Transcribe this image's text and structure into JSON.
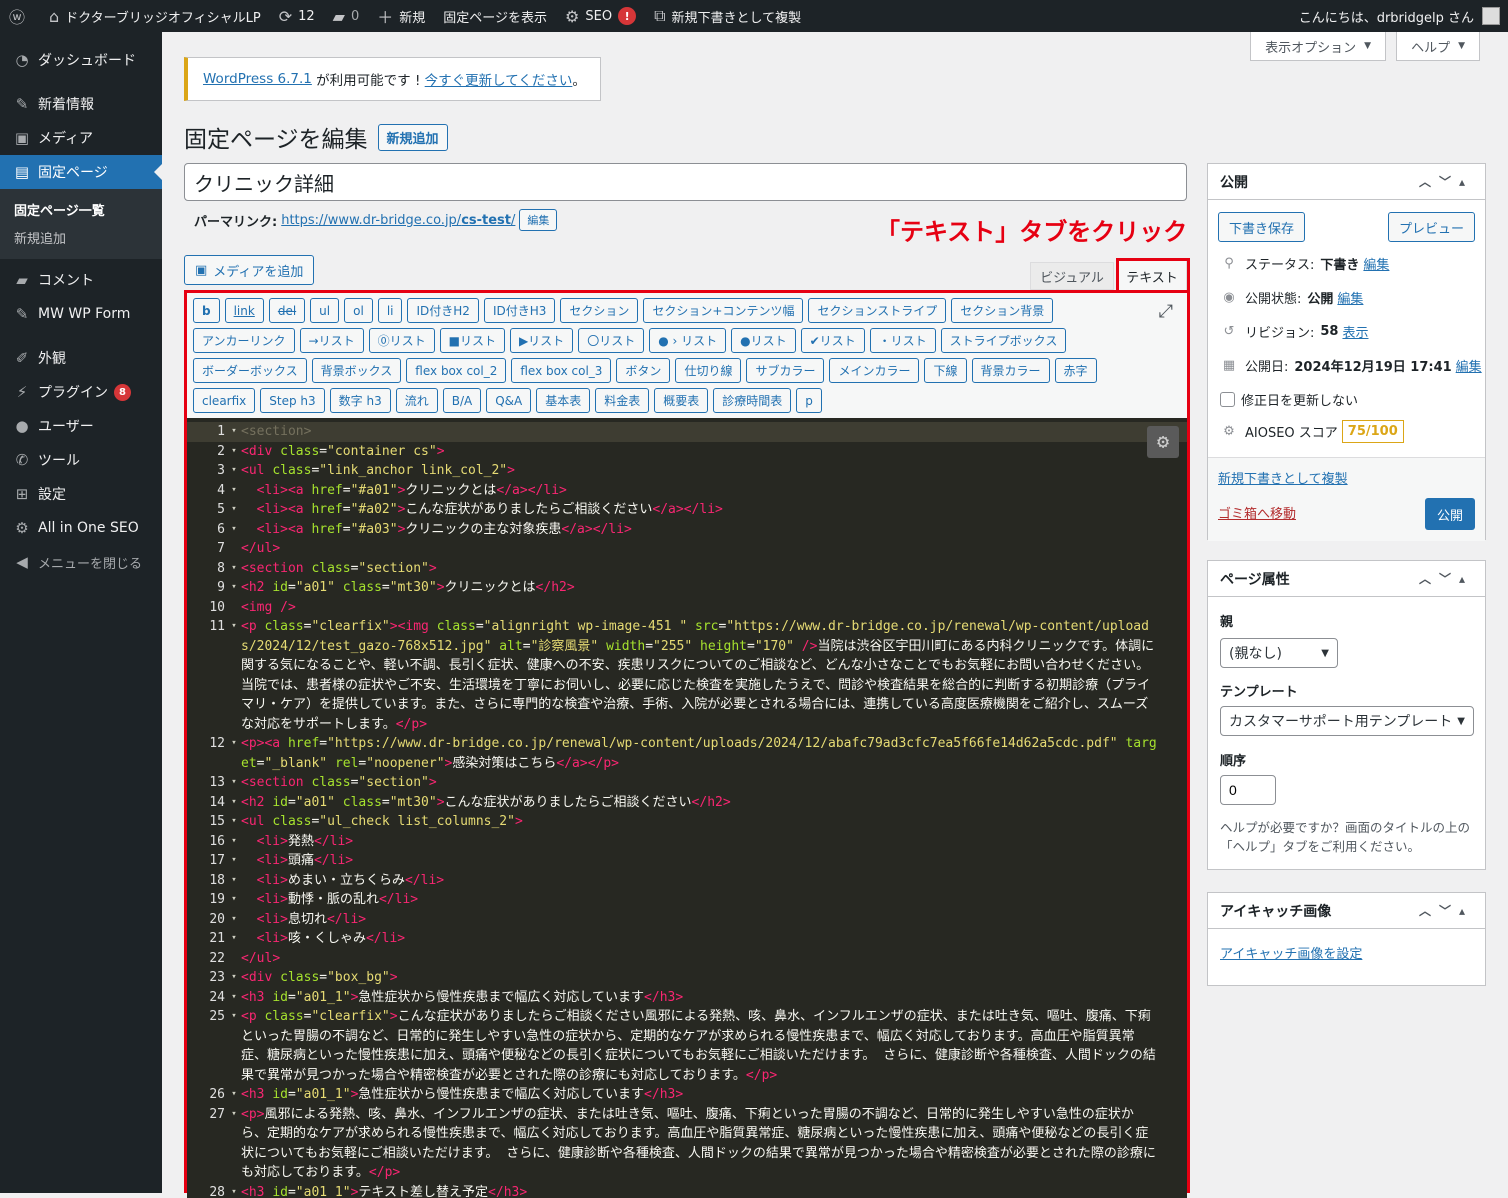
{
  "adminbar": {
    "site_name": "ドクターブリッジオフィシャルLP",
    "updates_count": "12",
    "comments_count": "0",
    "new_label": "新規",
    "view_page": "固定ページを表示",
    "seo_label": "SEO",
    "seo_badge": "!",
    "duplicate": "新規下書きとして複製",
    "greeting": "こんにちは、drbridgelp さん"
  },
  "sidebar": {
    "items": [
      {
        "label": "ダッシュボード",
        "icon": "dashboard-icon"
      },
      {
        "label": "新着情報",
        "icon": "pin-icon"
      },
      {
        "label": "メディア",
        "icon": "media-icon"
      },
      {
        "label": "固定ページ",
        "icon": "page-icon"
      },
      {
        "label": "コメント",
        "icon": "comment-icon"
      },
      {
        "label": "MW WP Form",
        "icon": "pin-icon"
      },
      {
        "label": "外観",
        "icon": "brush-icon"
      },
      {
        "label": "プラグイン",
        "icon": "plugin-icon",
        "badge": "8"
      },
      {
        "label": "ユーザー",
        "icon": "user-icon"
      },
      {
        "label": "ツール",
        "icon": "wrench-icon"
      },
      {
        "label": "設定",
        "icon": "settings-icon"
      },
      {
        "label": "All in One SEO",
        "icon": "aioseo-icon"
      }
    ],
    "submenu": [
      "固定ページ一覧",
      "新規追加"
    ],
    "collapse": "メニューを閉じる"
  },
  "screen_meta": {
    "options": "表示オプション",
    "help": "ヘルプ"
  },
  "notice": {
    "link1": "WordPress 6.7.1",
    "middle": " が利用可能です ! ",
    "link2": "今すぐ更新してください",
    "end": "。"
  },
  "page": {
    "heading": "固定ページを編集",
    "add_new": "新規追加",
    "title_value": "クリニック詳細",
    "permalink_label": "パーマリンク:",
    "permalink_base": "https://www.dr-bridge.co.jp/",
    "permalink_slug": "cs-test",
    "permalink_end": "/",
    "permalink_edit": "編集",
    "annotation": "「テキスト」タブをクリック",
    "add_media": "メディアを追加",
    "tab_visual": "ビジュアル",
    "tab_text": "テキスト"
  },
  "quicktags": [
    "b",
    "link",
    "del",
    "ul",
    "ol",
    "li",
    "ID付きH2",
    "ID付きH3",
    "セクション",
    "セクション+コンテンツ幅",
    "セクションストライプ",
    "セクション背景",
    "アンカーリンク",
    "→リスト",
    "⓪リスト",
    "■リスト",
    "▶リスト",
    "〇リスト",
    "● › リスト",
    "●リスト",
    "✔リスト",
    "・リスト",
    "ストライプボックス",
    "ボーダーボックス",
    "背景ボックス",
    "flex box col_2",
    "flex box col_3",
    "ボタン",
    "仕切り線",
    "サブカラー",
    "メインカラー",
    "下線",
    "背景カラー",
    "赤字",
    "clearfix",
    "Step h3",
    "数字 h3",
    "流れ",
    "B/A",
    "Q&A",
    "基本表",
    "料金表",
    "概要表",
    "診療時間表",
    "p"
  ],
  "code_lines": [
    {
      "n": "1",
      "f": "▾",
      "t": "<section>"
    },
    {
      "n": "2",
      "f": "▾",
      "t": "<div class=\"container cs\">"
    },
    {
      "n": "3",
      "f": "▾",
      "t": "<ul class=\"link_anchor link_col_2\">"
    },
    {
      "n": "4",
      "f": "▾",
      "t": "  <li><a href=\"#a01\">クリニックとは</a></li>"
    },
    {
      "n": "5",
      "f": "▾",
      "t": "  <li><a href=\"#a02\">こんな症状がありましたらご相談ください</a></li>"
    },
    {
      "n": "6",
      "f": "▾",
      "t": "  <li><a href=\"#a03\">クリニックの主な対象疾患</a></li>"
    },
    {
      "n": "7",
      "f": "",
      "t": "</ul>"
    },
    {
      "n": "8",
      "f": "▾",
      "t": "<section class=\"section\">"
    },
    {
      "n": "9",
      "f": "▾",
      "t": "<h2 id=\"a01\" class=\"mt30\">クリニックとは</h2>"
    },
    {
      "n": "10",
      "f": "",
      "t": "<img />"
    },
    {
      "n": "11",
      "f": "▾",
      "t": "<p class=\"clearfix\"><img class=\"alignright wp-image-451 \" src=\"https://www.dr-bridge.co.jp/renewal/wp-content/uploads/2024/12/test_gazo-768x512.jpg\" alt=\"診察風景\" width=\"255\" height=\"170\" />当院は渋谷区宇田川町にある内科クリニックです。体調に関する気になることや、軽い不調、長引く症状、健康への不安、疾患リスクについてのご相談など、どんな小さなことでもお気軽にお問い合わせください。当院では、患者様の症状やご不安、生活環境を丁寧にお伺いし、必要に応じた検査を実施したうえで、問診や検査結果を総合的に判断する初期診療（プライマリ・ケア）を提供しています。また、さらに専門的な検査や治療、手術、入院が必要とされる場合には、連携している高度医療機関をご紹介し、スムーズな対応をサポートします。</p>"
    },
    {
      "n": "12",
      "f": "▾",
      "t": "<p><a href=\"https://www.dr-bridge.co.jp/renewal/wp-content/uploads/2024/12/abafc79ad3cfc7ea5f66fe14d62a5cdc.pdf\" target=\"_blank\" rel=\"noopener\">感染対策はこちら</a></p>"
    },
    {
      "n": "13",
      "f": "▾",
      "t": "<section class=\"section\">"
    },
    {
      "n": "14",
      "f": "▾",
      "t": "<h2 id=\"a01\" class=\"mt30\">こんな症状がありましたらご相談ください</h2>"
    },
    {
      "n": "15",
      "f": "▾",
      "t": "<ul class=\"ul_check list_columns_2\">"
    },
    {
      "n": "16",
      "f": "▾",
      "t": "  <li>発熱</li>"
    },
    {
      "n": "17",
      "f": "▾",
      "t": "  <li>頭痛</li>"
    },
    {
      "n": "18",
      "f": "▾",
      "t": "  <li>めまい・立ちくらみ</li>"
    },
    {
      "n": "19",
      "f": "▾",
      "t": "  <li>動悸・脈の乱れ</li>"
    },
    {
      "n": "20",
      "f": "▾",
      "t": "  <li>息切れ</li>"
    },
    {
      "n": "21",
      "f": "▾",
      "t": "  <li>咳・くしゃみ</li>"
    },
    {
      "n": "22",
      "f": "",
      "t": "</ul>"
    },
    {
      "n": "23",
      "f": "▾",
      "t": "<div class=\"box_bg\">"
    },
    {
      "n": "24",
      "f": "▾",
      "t": "<h3 id=\"a01_1\">急性症状から慢性疾患まで幅広く対応しています</h3>"
    },
    {
      "n": "25",
      "f": "▾",
      "t": "<p class=\"clearfix\">こんな症状がありましたらご相談ください風邪による発熱、咳、鼻水、インフルエンザの症状、または吐き気、嘔吐、腹痛、下痢といった胃腸の不調など、日常的に発生しやすい急性の症状から、定期的なケアが求められる慢性疾患まで、幅広く対応しております。高血圧や脂質異常症、糖尿病といった慢性疾患に加え、頭痛や便秘などの長引く症状についてもお気軽にご相談いただけます。 さらに、健康診断や各種検査、人間ドックの結果で異常が見つかった場合や精密検査が必要とされた際の診療にも対応しております。</p>"
    },
    {
      "n": "26",
      "f": "▾",
      "t": "<h3 id=\"a01_1\">急性症状から慢性疾患まで幅広く対応しています</h3>"
    },
    {
      "n": "27",
      "f": "▾",
      "t": "<p>風邪による発熱、咳、鼻水、インフルエンザの症状、または吐き気、嘔吐、腹痛、下痢といった胃腸の不調など、日常的に発生しやすい急性の症状から、定期的なケアが求められる慢性疾患まで、幅広く対応しております。高血圧や脂質異常症、糖尿病といった慢性疾患に加え、頭痛や便秘などの長引く症状についてもお気軽にご相談いただけます。 さらに、健康診断や各種検査、人間ドックの結果で異常が見つかった場合や精密検査が必要とされた際の診療にも対応しております。</p>"
    },
    {
      "n": "28",
      "f": "▾",
      "t": "<h3 id=\"a01_1\">テキスト差し替え予定</h3>"
    }
  ],
  "publish": {
    "title": "公開",
    "save_draft": "下書き保存",
    "preview": "プレビュー",
    "status_label": "ステータス:",
    "status_value": "下書き",
    "visibility_label": "公開状態:",
    "visibility_value": "公開",
    "revisions_label": "リビジョン:",
    "revisions_value": "58",
    "revisions_link": "表示",
    "date_label": "公開日:",
    "date_value": "2024年12月19日 17:41",
    "edit": "編集",
    "no_update_date": "修正日を更新しない",
    "aioseo_label": "AIOSEO スコア",
    "aioseo_score": "75/100",
    "duplicate": "新規下書きとして複製",
    "trash": "ゴミ箱へ移動",
    "publish_button": "公開"
  },
  "attributes": {
    "title": "ページ属性",
    "parent_label": "親",
    "parent_value": "(親なし)",
    "template_label": "テンプレート",
    "template_value": "カスタマーサポート用テンプレート",
    "order_label": "順序",
    "order_value": "0",
    "help_text": "ヘルプが必要ですか？画面のタイトルの上の「ヘルプ」タブをご利用ください。"
  },
  "thumbnail": {
    "title": "アイキャッチ画像",
    "set_link": "アイキャッチ画像を設定"
  },
  "colors": {
    "accent": "#2271b1",
    "annotation": "#e60012",
    "adminbar": "#1d2327",
    "editor_bg": "#272822"
  }
}
